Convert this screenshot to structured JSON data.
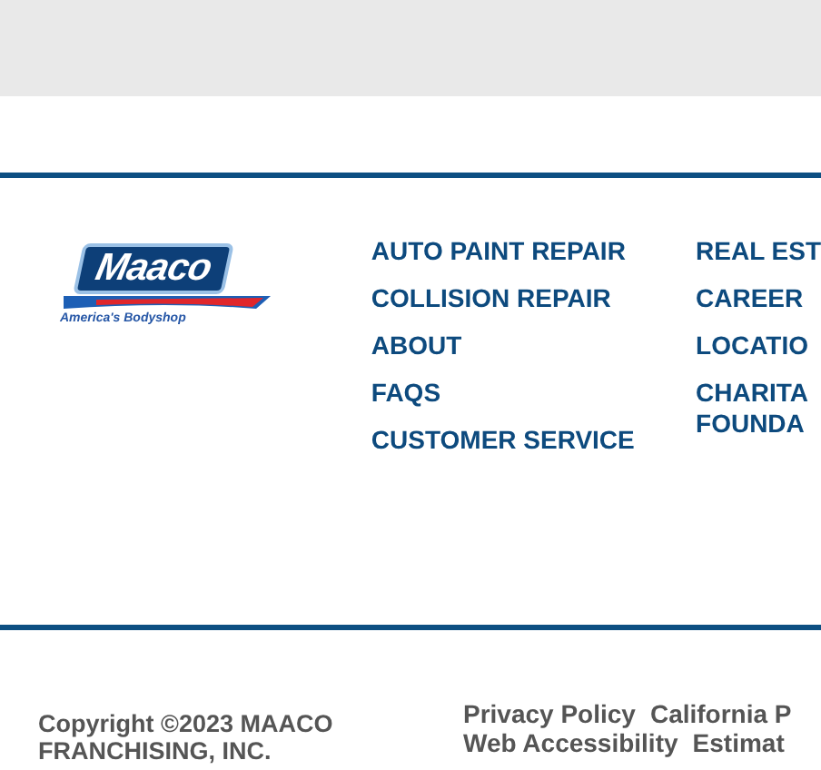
{
  "logo": {
    "wordmark": "Maaco",
    "tagline": "America's Bodyshop"
  },
  "footer_links": [
    [
      "AUTO PAINT REPAIR",
      "COLLISION REPAIR",
      "ABOUT",
      "FAQS",
      "CUSTOMER SERVICE"
    ],
    [
      "REAL EST",
      "CAREER",
      "LOCATIO",
      "CHARITA\nFOUNDA"
    ]
  ],
  "copyright": "Copyright ©2023 MAACO FRANCHISING, INC.",
  "legal_links": [
    [
      "Privacy Policy",
      "California P"
    ],
    [
      "Web Accessibility",
      "Estimat"
    ]
  ]
}
